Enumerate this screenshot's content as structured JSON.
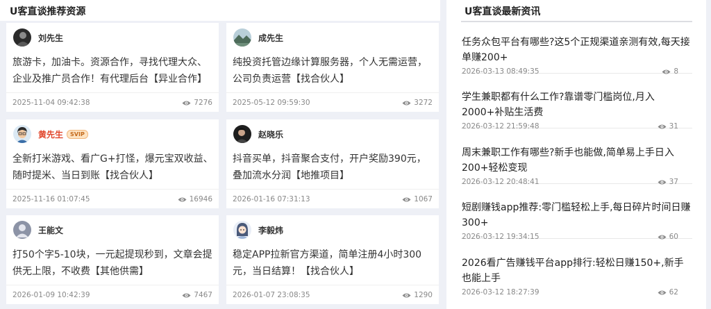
{
  "left": {
    "title": "U客直谈推荐资源",
    "cards": [
      {
        "author": "刘先生",
        "vip": "",
        "content": "旅游卡，加油卡。资源合作，寻找代理大众、企业及推广员合作！有代理后台【异业合作】",
        "date": "2025-11-04 09:42:38",
        "views": "7276",
        "avatar_icon": "dark-portrait"
      },
      {
        "author": "成先生",
        "vip": "",
        "content": "纯投资托管边缘计算服务器，个人无需运营，公司负责运营【找合伙人】",
        "date": "2025-05-12 09:59:30",
        "views": "3272",
        "avatar_icon": "landscape-photo"
      },
      {
        "author": "黄先生",
        "vip": "SVIP",
        "content": "全新打米游戏、看广G+打怪，爆元宝双收益、随时提米、当日到账【找合伙人】",
        "date": "2025-11-16 01:07:45",
        "views": "16946",
        "avatar_icon": "cartoon-man"
      },
      {
        "author": "赵晓乐",
        "vip": "",
        "content": "抖音买单，抖音聚合支付，开户奖励390元，叠加流水分润【地推项目】",
        "date": "2026-01-16 07:31:13",
        "views": "1067",
        "avatar_icon": "dark-portrait"
      },
      {
        "author": "王能文",
        "vip": "",
        "content": "打50个字5-10块，一元起提现秒到，文章会提供无上限，不收费【其他供需】",
        "date": "2026-01-09 10:42:39",
        "views": "7467",
        "avatar_icon": "default-user"
      },
      {
        "author": "李毅炜",
        "vip": "",
        "content": "稳定APP拉新官方渠道，简单注册4小时300元，当日结算！【找合伙人】",
        "date": "2026-01-07 23:08:35",
        "views": "1290",
        "avatar_icon": "anime-girl"
      }
    ]
  },
  "right": {
    "title": "U客直谈最新资讯",
    "news": [
      {
        "title": "任务众包平台有哪些?这5个正规渠道亲测有效,每天接单赚200+",
        "date": "2026-03-13 08:49:35",
        "views": "8"
      },
      {
        "title": "学生兼职都有什么工作?靠谱零门槛岗位,月入2000+补贴生活费",
        "date": "2026-03-12 21:59:48",
        "views": "31"
      },
      {
        "title": "周末兼职工作有哪些?新手也能做,简单易上手日入200+轻松变现",
        "date": "2026-03-12 20:48:41",
        "views": "37"
      },
      {
        "title": "短剧赚钱app推荐:零门槛轻松上手,每日碎片时间日赚300+",
        "date": "2026-03-12 19:34:15",
        "views": "60"
      },
      {
        "title": "2026看广告赚钱平台app排行:轻松日赚150+,新手也能上手",
        "date": "2026-03-12 18:27:39",
        "views": "62"
      }
    ]
  },
  "colors": {
    "page_bg": "#eef0f6",
    "vip_name": "#e1462c",
    "meta_text": "#888888"
  }
}
